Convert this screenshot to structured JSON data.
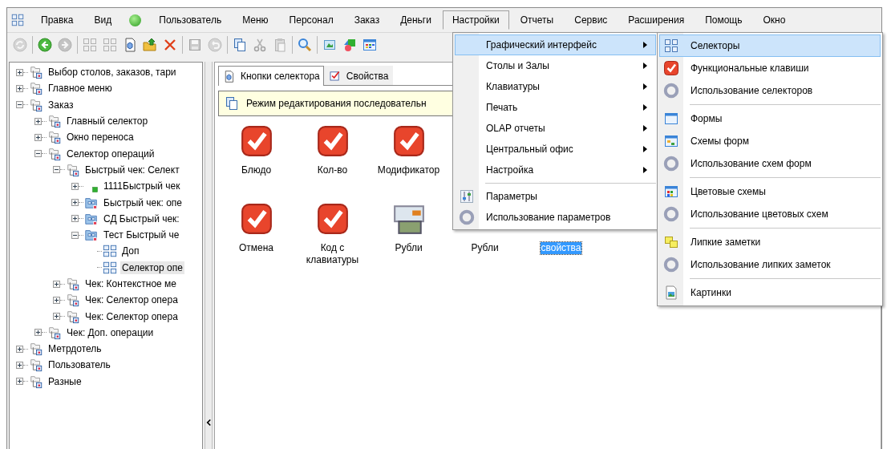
{
  "menubar": [
    {
      "kind": "grid",
      "selected": false
    },
    {
      "kind": "text",
      "label": "Правка",
      "selected": false
    },
    {
      "kind": "text",
      "label": "Вид",
      "selected": false
    },
    {
      "kind": "dot",
      "selected": false
    },
    {
      "kind": "text",
      "label": "Пользователь",
      "selected": false
    },
    {
      "kind": "text",
      "label": "Меню",
      "selected": false
    },
    {
      "kind": "text",
      "label": "Персонал",
      "selected": false
    },
    {
      "kind": "text",
      "label": "Заказ",
      "selected": false
    },
    {
      "kind": "text",
      "label": "Деньги",
      "selected": false
    },
    {
      "kind": "text",
      "label": "Настройки",
      "selected": true
    },
    {
      "kind": "text",
      "label": "Отчеты",
      "selected": false
    },
    {
      "kind": "text",
      "label": "Сервис",
      "selected": false
    },
    {
      "kind": "text",
      "label": "Расширения",
      "selected": false
    },
    {
      "kind": "text",
      "label": "Помощь",
      "selected": false
    },
    {
      "kind": "text",
      "label": "Окно",
      "selected": false
    }
  ],
  "toolbar": [
    {
      "kind": "refresh",
      "disabled": true
    },
    {
      "kind": "separator"
    },
    {
      "kind": "back",
      "disabled": false
    },
    {
      "kind": "forward",
      "disabled": true
    },
    {
      "kind": "separator"
    },
    {
      "kind": "grid",
      "disabled": true
    },
    {
      "kind": "grid",
      "disabled": true
    },
    {
      "kind": "page",
      "disabled": false
    },
    {
      "kind": "folder-up",
      "disabled": false
    },
    {
      "kind": "delete",
      "disabled": false
    },
    {
      "kind": "separator"
    },
    {
      "kind": "save",
      "disabled": true
    },
    {
      "kind": "undo",
      "disabled": true
    },
    {
      "kind": "separator"
    },
    {
      "kind": "copy",
      "disabled": false
    },
    {
      "kind": "cut",
      "disabled": true
    },
    {
      "kind": "paste",
      "disabled": true
    },
    {
      "kind": "separator"
    },
    {
      "kind": "search",
      "disabled": false
    },
    {
      "kind": "separator"
    },
    {
      "kind": "image",
      "disabled": false
    },
    {
      "kind": "shapes",
      "disabled": false
    },
    {
      "kind": "table",
      "disabled": false
    }
  ],
  "tree": [
    {
      "label": "Выбор столов, заказов, тари",
      "kind": "folder",
      "expanded": false,
      "selected": false
    },
    {
      "label": "Главное меню",
      "kind": "folder",
      "expanded": false,
      "selected": false
    },
    {
      "label": "Заказ",
      "kind": "folder",
      "expanded": true,
      "selected": false,
      "children": [
        {
          "label": "Главный селектор",
          "kind": "folder",
          "expanded": false,
          "selected": false
        },
        {
          "label": "Окно переноса",
          "kind": "folder",
          "expanded": false,
          "selected": false
        },
        {
          "label": "Селектор операций",
          "kind": "folder",
          "expanded": true,
          "selected": false,
          "children": [
            {
              "label": "Быстрый чек: Селект",
              "kind": "folder",
              "expanded": true,
              "selected": false,
              "children": [
                {
                  "label": "1111Быстрый чек",
                  "kind": "green",
                  "expanded": false,
                  "selected": false
                },
                {
                  "label": "Быстрый чек: опе",
                  "kind": "group",
                  "expanded": false,
                  "selected": false
                },
                {
                  "label": "СД Быстрый чек:",
                  "kind": "group",
                  "expanded": false,
                  "selected": false
                },
                {
                  "label": "Тест Быстрый че",
                  "kind": "group",
                  "expanded": true,
                  "selected": false,
                  "children": [
                    {
                      "label": "Доп",
                      "kind": "selector",
                      "selected": false
                    },
                    {
                      "label": "Селектор опе",
                      "kind": "selector",
                      "selected": true
                    }
                  ]
                }
              ]
            },
            {
              "label": "Чек: Контекстное ме",
              "kind": "folder",
              "expanded": false,
              "selected": false
            },
            {
              "label": "Чек: Селектор опера",
              "kind": "folder",
              "expanded": false,
              "selected": false
            },
            {
              "label": "Чек: Селектор опера",
              "kind": "folder",
              "expanded": false,
              "selected": false
            }
          ]
        },
        {
          "label": "Чек: Доп. операции",
          "kind": "folder",
          "expanded": false,
          "selected": false
        }
      ]
    },
    {
      "label": "Метрдотель",
      "kind": "folder",
      "expanded": false,
      "selected": false
    },
    {
      "label": "Пользователь",
      "kind": "folder",
      "expanded": false,
      "selected": false
    },
    {
      "label": "Разные",
      "kind": "folder",
      "expanded": false,
      "selected": false
    }
  ],
  "tabs": [
    {
      "label": "Кнопки селектора",
      "kind": "page",
      "selected": true
    },
    {
      "label": "Свойства",
      "kind": "checkbox",
      "selected": false
    }
  ],
  "hint": {
    "text": "Режим редактирования последовательн"
  },
  "buttons": [
    [
      {
        "label": "Блюдо",
        "kind": "check",
        "selected": false
      },
      {
        "label": "Кол-во",
        "kind": "check",
        "selected": false
      },
      {
        "label": "Модификатор",
        "kind": "check",
        "selected": false
      }
    ],
    [
      {
        "label": "Отмена",
        "kind": "check",
        "selected": false
      },
      {
        "label": "Код с клавиатуры",
        "kind": "check",
        "selected": false
      },
      {
        "label": "Рубли",
        "kind": "money",
        "selected": false
      },
      {
        "label": "Рубли",
        "selected": false
      },
      {
        "label": "свойства",
        "selected": true
      }
    ]
  ],
  "menu": [
    {
      "kind": "submenu",
      "label": "Графический интерфейс",
      "selected": true
    },
    {
      "kind": "submenu",
      "label": "Столы и Залы",
      "selected": false
    },
    {
      "kind": "submenu",
      "label": "Клавиатуры",
      "selected": false
    },
    {
      "kind": "submenu",
      "label": "Печать",
      "selected": false
    },
    {
      "kind": "submenu",
      "label": "OLAP отчеты",
      "selected": false
    },
    {
      "kind": "submenu",
      "label": "Центральный офис",
      "selected": false
    },
    {
      "kind": "submenu",
      "label": "Настройка",
      "selected": false
    },
    {
      "kind": "separator"
    },
    {
      "kind": "sliders",
      "label": "Параметры",
      "selected": false
    },
    {
      "kind": "gear",
      "label": "Использование параметров",
      "selected": false
    }
  ],
  "submenu": [
    {
      "kind": "grid",
      "label": "Селекторы",
      "selected": true
    },
    {
      "kind": "check",
      "label": "Функциональные клавиши",
      "selected": false
    },
    {
      "kind": "gear",
      "label": "Использование селекторов",
      "selected": false
    },
    {
      "kind": "separator"
    },
    {
      "kind": "window",
      "label": "Формы",
      "selected": false
    },
    {
      "kind": "scheme",
      "label": "Схемы форм",
      "selected": false
    },
    {
      "kind": "gear",
      "label": "Использование схем форм",
      "selected": false
    },
    {
      "kind": "separator"
    },
    {
      "kind": "colors",
      "label": "Цветовые схемы",
      "selected": false
    },
    {
      "kind": "gear",
      "label": "Использование цветовых схем",
      "selected": false
    },
    {
      "kind": "separator"
    },
    {
      "kind": "notes",
      "label": "Липкие заметки",
      "selected": false
    },
    {
      "kind": "gear",
      "label": "Использование липких заметок",
      "selected": false
    },
    {
      "kind": "separator"
    },
    {
      "kind": "picture",
      "label": "Картинки",
      "selected": false
    }
  ]
}
